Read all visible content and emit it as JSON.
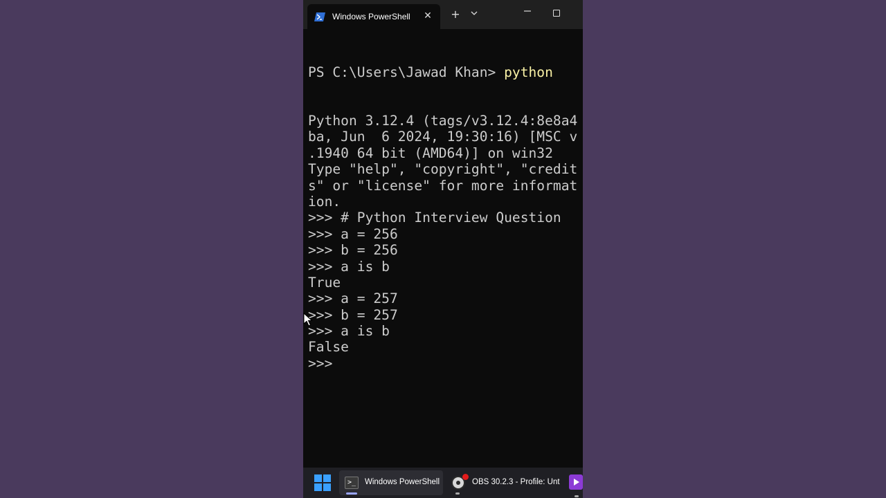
{
  "window": {
    "tab_title": "Windows PowerShell",
    "tab_close_glyph": "✕",
    "new_tab_glyph": "+",
    "dropdown_glyph": "⌄",
    "minimize_glyph": "—",
    "icon": "powershell-icon"
  },
  "terminal": {
    "prompt": "PS C:\\Users\\Jawad Khan> ",
    "command": "python",
    "lines": [
      "Python 3.12.4 (tags/v3.12.4:8e8a4",
      "ba, Jun  6 2024, 19:30:16) [MSC v",
      ".1940 64 bit (AMD64)] on win32",
      "Type \"help\", \"copyright\", \"credit",
      "s\" or \"license\" for more informat",
      "ion.",
      ">>> # Python Interview Question",
      ">>> a = 256",
      ">>> b = 256",
      ">>> a is b",
      "True",
      ">>> a = 257",
      ">>> b = 257",
      ">>> a is b",
      "False",
      ">>> "
    ],
    "colors": {
      "background": "#0c0c0c",
      "text": "#cccccc",
      "command": "#f9f1a5"
    }
  },
  "taskbar": {
    "start_icon": "windows-start-icon",
    "items": [
      {
        "label": "Windows PowerShell",
        "icon": "terminal-icon",
        "active": true
      },
      {
        "label": "OBS 30.2.3 - Profile: Unt",
        "icon": "obs-icon",
        "recording": true
      },
      {
        "label": "",
        "icon": "video-app-icon"
      }
    ]
  },
  "colors": {
    "page_background": "#4a3a5d",
    "titlebar": "#202020",
    "taskbar": "#1f1f24",
    "accent": "#3aa0ff"
  }
}
